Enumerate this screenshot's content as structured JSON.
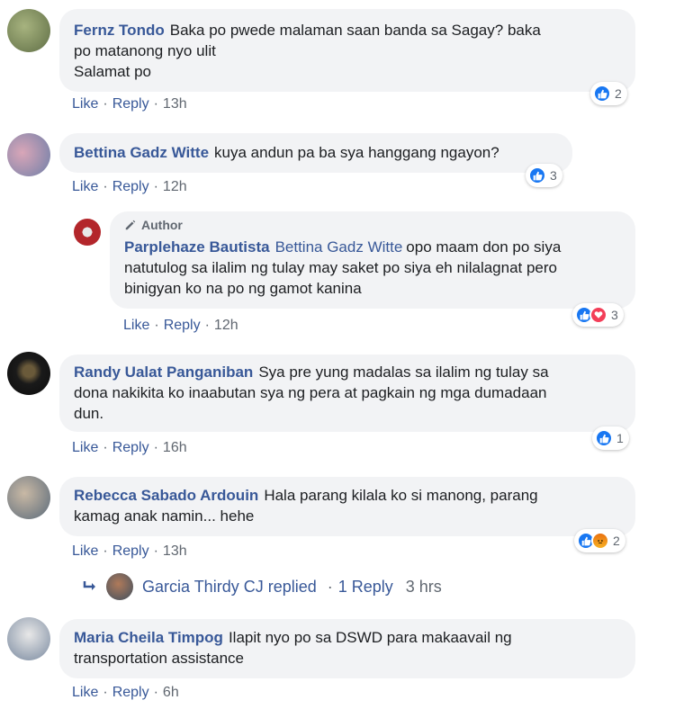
{
  "comments": [
    {
      "name": "Fernz Tondo",
      "text_lines": [
        "Baka po pwede malaman saan banda sa Sagay? baka",
        "po matanong nyo ulit",
        "Salamat po"
      ],
      "like": "Like",
      "reply": "Reply",
      "time": "13h",
      "reaction_count": "2"
    },
    {
      "name": "Bettina Gadz Witte",
      "text": "kuya andun pa ba sya hanggang ngayon?",
      "like": "Like",
      "reply": "Reply",
      "time": "12h",
      "reaction_count": "3"
    },
    {
      "badge": "Author",
      "name": "Parplehaze Bautista",
      "tag": "Bettina Gadz Witte",
      "text_lines": [
        "opo maam don po siya",
        "natutulog sa ilalim ng tulay may saket po siya eh nilalagnat pero",
        "binigyan ko na po ng gamot kanina"
      ],
      "like": "Like",
      "reply": "Reply",
      "time": "12h",
      "reaction_count": "3"
    },
    {
      "name": "Randy Ualat Panganiban",
      "text_lines": [
        "Sya pre yung madalas sa ilalim ng tulay sa",
        "dona nakikita ko inaabutan sya ng pera at pagkain ng mga dumadaan",
        "dun."
      ],
      "like": "Like",
      "reply": "Reply",
      "time": "16h",
      "reaction_count": "1"
    },
    {
      "name": "Rebecca Sabado Ardouin",
      "text_lines": [
        "Hala parang kilala ko si manong, parang",
        "kamag anak namin... hehe"
      ],
      "like": "Like",
      "reply": "Reply",
      "time": "13h",
      "reaction_count": "2"
    },
    {
      "name": "Maria Cheila Timpog",
      "text_lines": [
        "Ilapit nyo po sa DSWD para makaavail ng",
        "transportation assistance"
      ],
      "like": "Like",
      "reply": "Reply",
      "time": "6h"
    }
  ],
  "replied": {
    "text": "Garcia Thirdy CJ replied",
    "count": "1 Reply",
    "time": "3 hrs"
  },
  "separator": "·",
  "colors": {
    "link": "#385898",
    "bubble": "#f2f3f5",
    "like": "#1877f2",
    "love": "#f33e58",
    "angry": "#f7b125"
  }
}
